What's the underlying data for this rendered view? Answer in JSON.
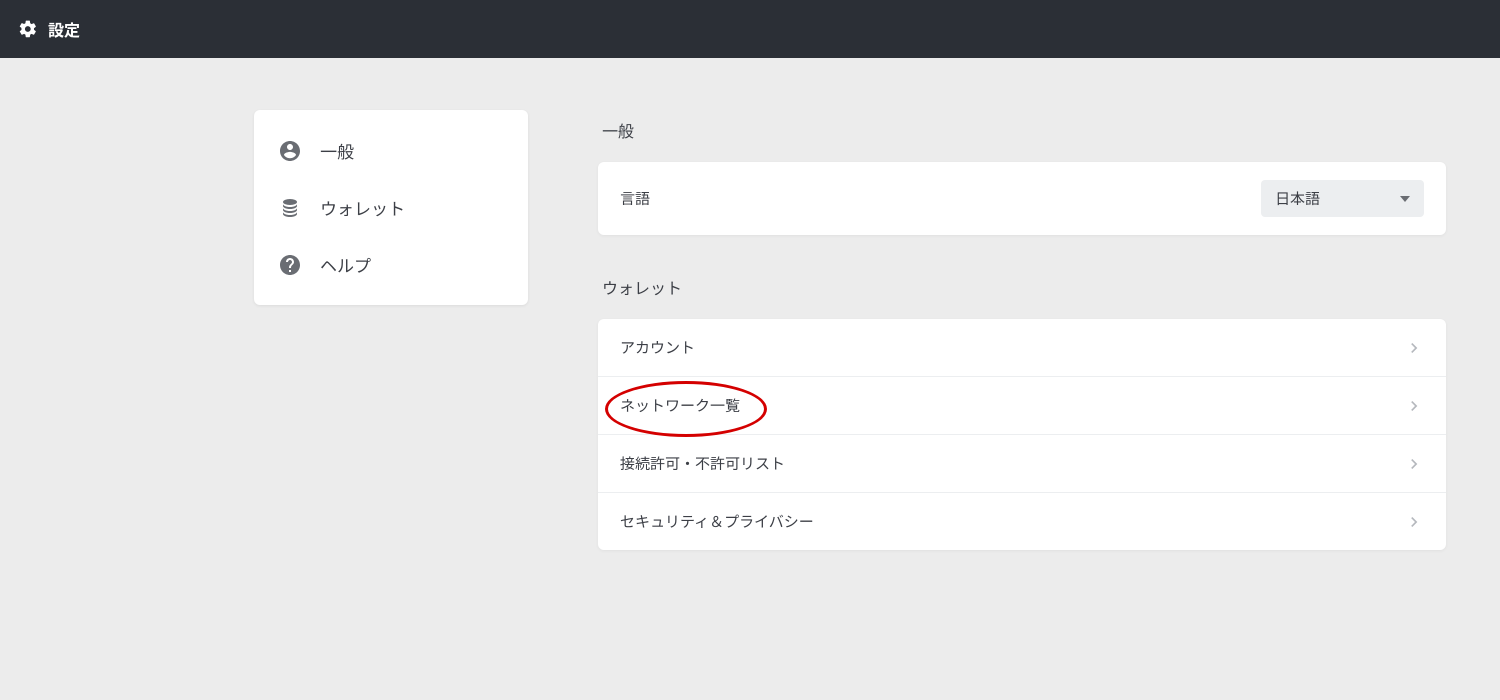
{
  "header": {
    "title": "設定"
  },
  "sidebar": {
    "items": [
      {
        "label": "一般",
        "icon": "user-circle-icon"
      },
      {
        "label": "ウォレット",
        "icon": "stack-icon"
      },
      {
        "label": "ヘルプ",
        "icon": "help-circle-icon"
      }
    ]
  },
  "sections": {
    "general": {
      "title": "一般",
      "language_label": "言語",
      "language_value": "日本語"
    },
    "wallet": {
      "title": "ウォレット",
      "items": [
        {
          "label": "アカウント"
        },
        {
          "label": "ネットワーク一覧",
          "highlighted": true
        },
        {
          "label": "接続許可・不許可リスト"
        },
        {
          "label": "セキュリティ＆プライバシー"
        }
      ]
    }
  }
}
